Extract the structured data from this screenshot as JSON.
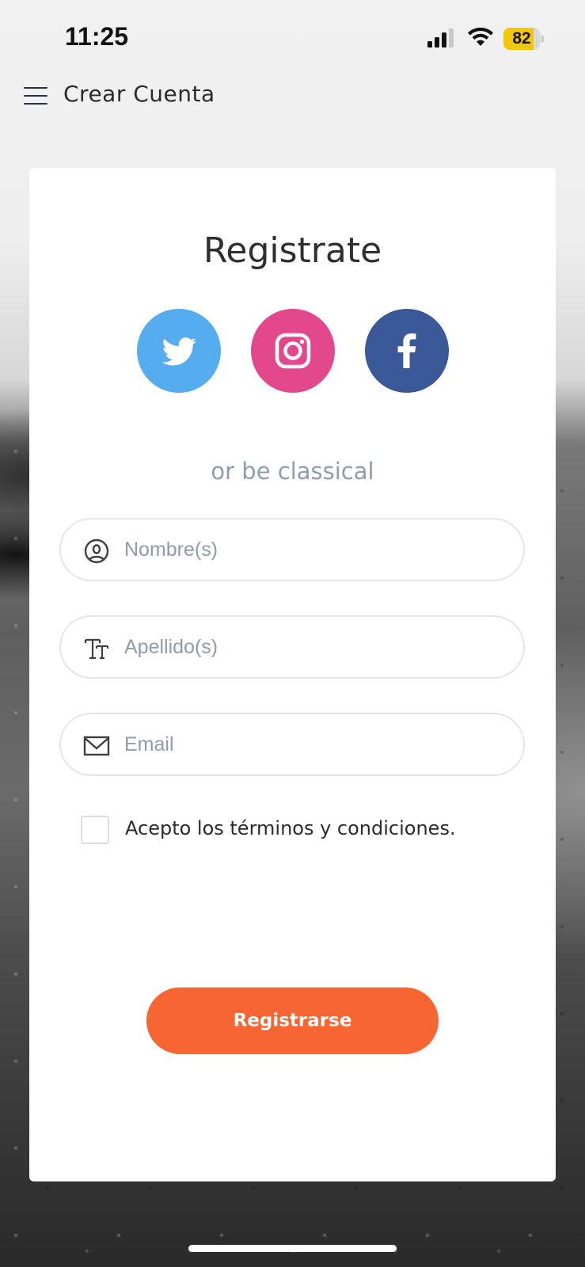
{
  "status_bar": {
    "time": "11:25",
    "battery_level": "82",
    "battery_color": "#f4c60a"
  },
  "nav": {
    "menu_icon": "hamburger-menu-icon",
    "title": "Crear Cuenta"
  },
  "card": {
    "title": "Registrate",
    "social": [
      {
        "name": "twitter",
        "icon": "twitter-bird-icon",
        "color": "#55acee"
      },
      {
        "name": "instagram",
        "icon": "instagram-camera-icon",
        "color": "#e4488c"
      },
      {
        "name": "facebook",
        "icon": "facebook-f-icon",
        "color": "#3b5998"
      }
    ],
    "divider_text": "or be classical",
    "fields": {
      "name": {
        "placeholder": "Nombre(s)",
        "value": "",
        "icon": "user-circle-icon"
      },
      "lastname": {
        "placeholder": "Apellido(s)",
        "value": "",
        "icon": "text-size-icon"
      },
      "email": {
        "placeholder": "Email",
        "value": "",
        "icon": "envelope-icon"
      }
    },
    "terms": {
      "checked": false,
      "label": "Acepto los términos y condiciones."
    },
    "submit_label": "Registrarse",
    "submit_color": "#f76532"
  }
}
